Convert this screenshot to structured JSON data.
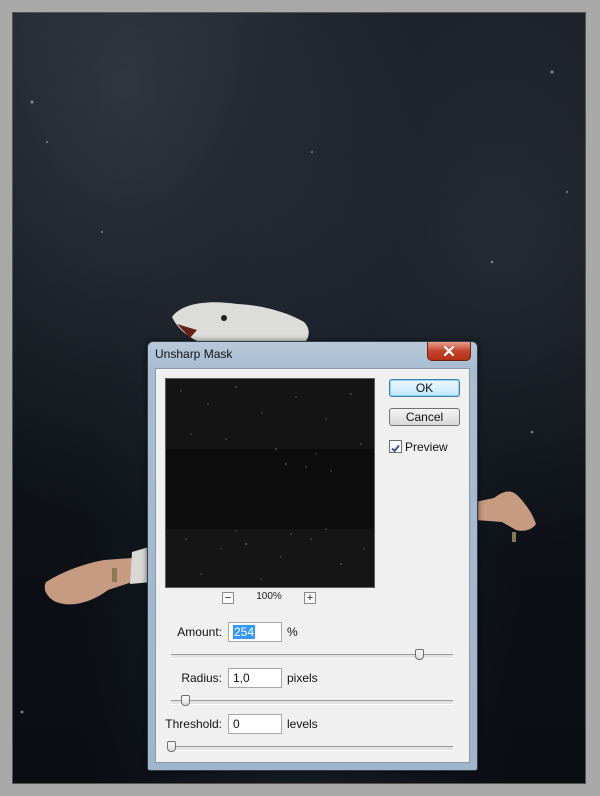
{
  "dialog": {
    "title": "Unsharp Mask",
    "ok_label": "OK",
    "cancel_label": "Cancel",
    "preview_label": "Preview",
    "preview_checked": true,
    "zoom_level": "100%",
    "zoom_minus": "−",
    "zoom_plus": "+",
    "amount": {
      "label": "Amount:",
      "value": "254",
      "unit": "%",
      "slider_fraction": 0.88
    },
    "radius": {
      "label": "Radius:",
      "value": "1,0",
      "unit": "pixels",
      "slider_fraction": 0.05
    },
    "threshold": {
      "label": "Threshold:",
      "value": "0",
      "unit": "levels",
      "slider_fraction": 0.0
    }
  },
  "icons": {
    "close": "close-icon",
    "check": "checkmark-icon"
  },
  "colors": {
    "accent": "#3399ff",
    "close_button": "#c4432b",
    "background": "#0e1218"
  }
}
